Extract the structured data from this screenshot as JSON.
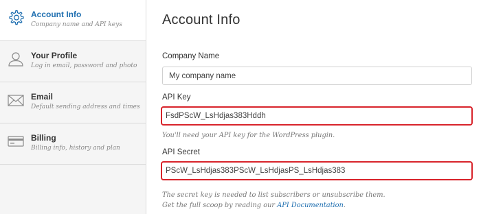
{
  "sidebar": {
    "items": [
      {
        "title": "Account Info",
        "subtitle": "Company name and API keys",
        "icon": "gear-icon",
        "active": true
      },
      {
        "title": "Your Profile",
        "subtitle": "Log in email, password and photo",
        "icon": "user-icon",
        "active": false
      },
      {
        "title": "Email",
        "subtitle": "Default sending address and times",
        "icon": "envelope-icon",
        "active": false
      },
      {
        "title": "Billing",
        "subtitle": "Billing info, history and plan",
        "icon": "credit-card-icon",
        "active": false
      }
    ]
  },
  "main": {
    "title": "Account Info",
    "company": {
      "label": "Company Name",
      "value": "My company name"
    },
    "api_key": {
      "label": "API Key",
      "value": "FsdPScW_LsHdjas383Hddh",
      "hint": "You'll need your API key for the WordPress plugin."
    },
    "api_secret": {
      "label": "API Secret",
      "value": "PScW_LsHdjas383PScW_LsHdjasPS_LsHdjas383",
      "hint_line1": "The secret key is needed to list subscribers or unsubscribe them.",
      "hint_line2_prefix": "Get the full scoop by reading our ",
      "hint_link": "API Documentation",
      "hint_line2_suffix": "."
    }
  },
  "colors": {
    "accent": "#1f6fb0",
    "highlight": "#d8232a",
    "sidebar_bg": "#f5f5f5"
  }
}
